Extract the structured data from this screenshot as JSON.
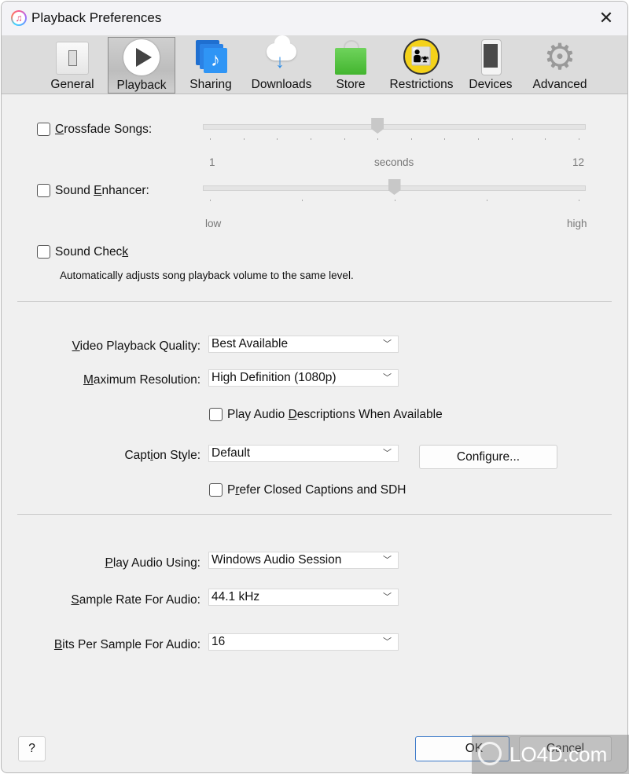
{
  "window": {
    "title": "Playback Preferences",
    "close_icon": "close-icon",
    "app_icon": "itunes-icon"
  },
  "toolbar": {
    "tabs": [
      {
        "label": "General",
        "icon": "general-switch-icon",
        "active": false
      },
      {
        "label": "Playback",
        "icon": "play-icon",
        "active": true
      },
      {
        "label": "Sharing",
        "icon": "music-library-icon",
        "active": false
      },
      {
        "label": "Downloads",
        "icon": "cloud-download-icon",
        "active": false
      },
      {
        "label": "Store",
        "icon": "shopping-bag-icon",
        "active": false
      },
      {
        "label": "Restrictions",
        "icon": "parental-controls-icon",
        "active": false
      },
      {
        "label": "Devices",
        "icon": "phone-icon",
        "active": false
      },
      {
        "label": "Advanced",
        "icon": "gear-icon",
        "active": false
      }
    ]
  },
  "audio": {
    "crossfade": {
      "label_prefix": "",
      "label_mnemonic": "C",
      "label_rest": "rossfade Songs:",
      "checked": false,
      "value": 6,
      "min": 1,
      "max": 12,
      "min_label": "1",
      "mid_label": "seconds",
      "max_label": "12"
    },
    "sound_enhancer": {
      "label_prefix": "Sound ",
      "label_mnemonic": "E",
      "label_rest": "nhancer:",
      "checked": false,
      "value_fraction": 0.5,
      "min_label": "low",
      "max_label": "high"
    },
    "sound_check": {
      "label_prefix": "Sound Chec",
      "label_mnemonic": "k",
      "label_rest": "",
      "checked": false,
      "description": "Automatically adjusts song playback volume to the same level."
    }
  },
  "video": {
    "quality": {
      "label_mnemonic": "V",
      "label_rest": "ideo Playback Quality:",
      "value": "Best Available"
    },
    "resolution": {
      "label_mnemonic": "M",
      "label_rest": "aximum Resolution:",
      "value": "High Definition (1080p)"
    },
    "audio_descriptions": {
      "label_prefix": "Play Audio ",
      "label_mnemonic": "D",
      "label_rest": "escriptions When Available",
      "checked": false
    },
    "caption_style": {
      "label_prefix": "Capt",
      "label_mnemonic": "i",
      "label_rest": "on Style:",
      "value": "Default"
    },
    "configure_button": {
      "label_prefix": "Confi",
      "label_mnemonic": "g",
      "label_rest": "ure..."
    },
    "prefer_cc": {
      "label_prefix": "P",
      "label_mnemonic": "r",
      "label_rest": "efer Closed Captions and SDH",
      "checked": false
    }
  },
  "output": {
    "play_audio_using": {
      "label_mnemonic": "P",
      "label_rest": "lay Audio Using:",
      "value": "Windows Audio Session"
    },
    "sample_rate": {
      "label_mnemonic": "S",
      "label_rest": "ample Rate For Audio:",
      "value": "44.1 kHz"
    },
    "bits_per_sample": {
      "label_mnemonic": "B",
      "label_rest": "its Per Sample For Audio:",
      "value": "16"
    }
  },
  "footer": {
    "help_label": "?",
    "ok_label": "OK",
    "cancel_label": "Cancel"
  },
  "watermark": {
    "text": "LO4D.com"
  }
}
